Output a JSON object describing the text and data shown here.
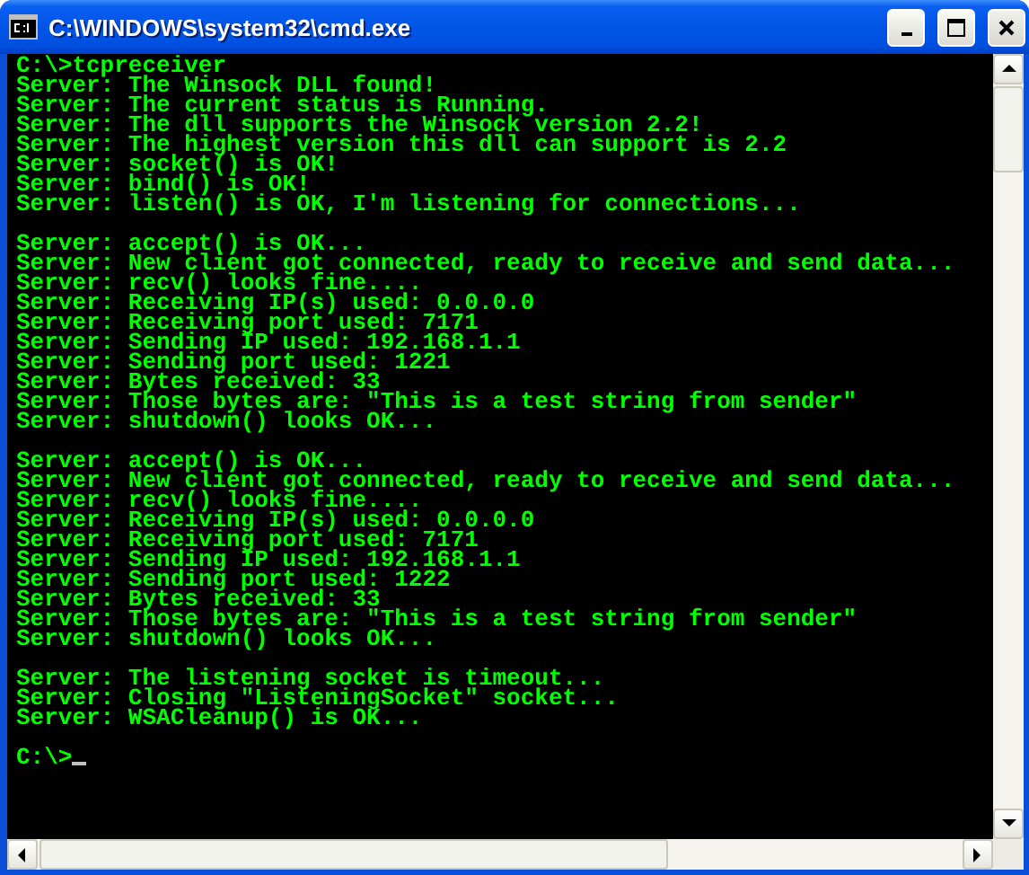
{
  "window": {
    "title": "C:\\WINDOWS\\system32\\cmd.exe"
  },
  "console": {
    "command_line": "C:\\>tcpreceiver",
    "blocks": [
      [
        "Server: The Winsock DLL found!",
        "Server: The current status is Running.",
        "Server: The dll supports the Winsock version 2.2!",
        "Server: The highest version this dll can support is 2.2",
        "Server: socket() is OK!",
        "Server: bind() is OK!",
        "Server: listen() is OK, I'm listening for connections..."
      ],
      [
        "Server: accept() is OK...",
        "Server: New client got connected, ready to receive and send data...",
        "Server: recv() looks fine....",
        "Server: Receiving IP(s) used: 0.0.0.0",
        "Server: Receiving port used: 7171",
        "Server: Sending IP used: 192.168.1.1",
        "Server: Sending port used: 1221",
        "Server: Bytes received: 33",
        "Server: Those bytes are: \"This is a test string from sender\"",
        "Server: shutdown() looks OK..."
      ],
      [
        "Server: accept() is OK...",
        "Server: New client got connected, ready to receive and send data...",
        "Server: recv() looks fine....",
        "Server: Receiving IP(s) used: 0.0.0.0",
        "Server: Receiving port used: 7171",
        "Server: Sending IP used: 192.168.1.1",
        "Server: Sending port used: 1222",
        "Server: Bytes received: 33",
        "Server: Those bytes are: \"This is a test string from sender\"",
        "Server: shutdown() looks OK..."
      ],
      [
        "Server: The listening socket is timeout...",
        "Server: Closing \"ListeningSocket\" socket...",
        "Server: WSACleanup() is OK..."
      ]
    ],
    "prompt": "C:\\>"
  }
}
